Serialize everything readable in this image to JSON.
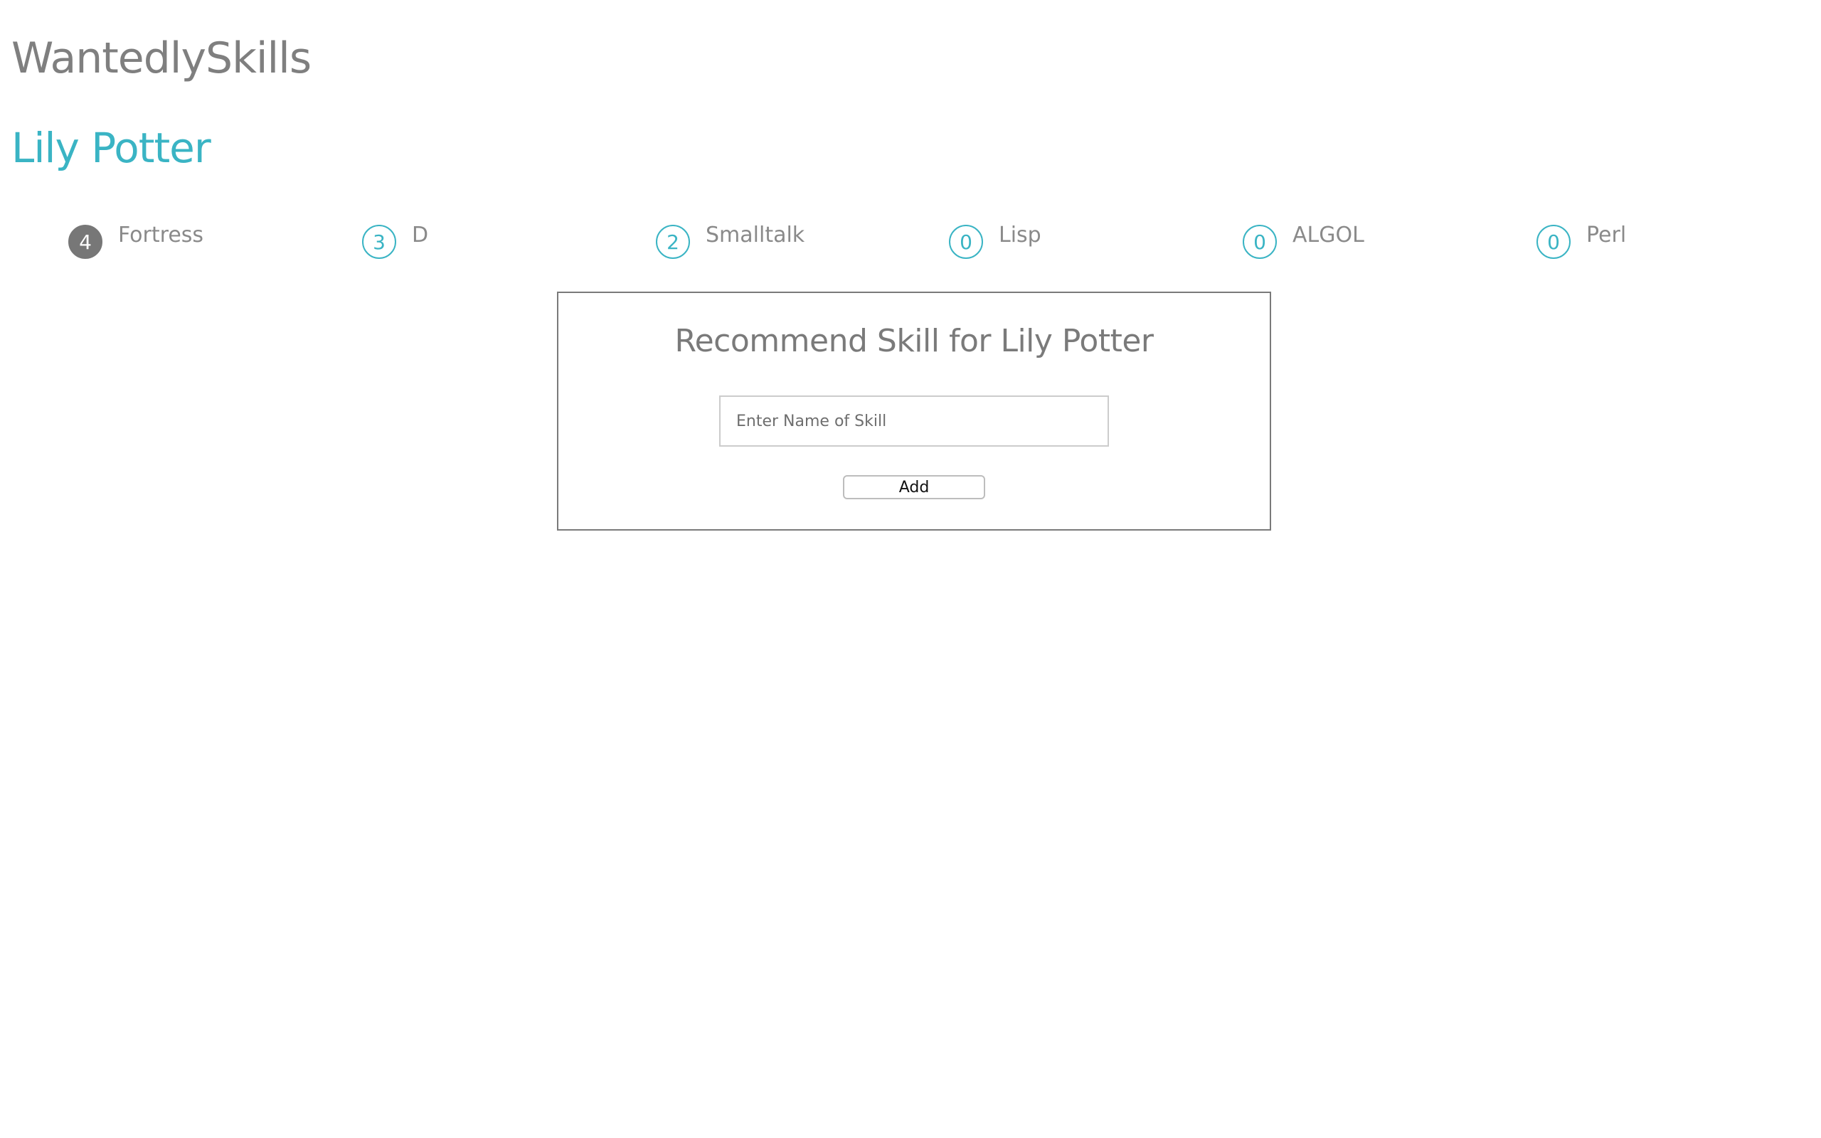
{
  "header": {
    "app_title": "WantedlySkills"
  },
  "profile": {
    "name": "Lily Potter"
  },
  "skills": [
    {
      "count": "4",
      "name": "Fortress",
      "active": true
    },
    {
      "count": "3",
      "name": "D",
      "active": false
    },
    {
      "count": "2",
      "name": "Smalltalk",
      "active": false
    },
    {
      "count": "0",
      "name": "Lisp",
      "active": false
    },
    {
      "count": "0",
      "name": "ALGOL",
      "active": false
    },
    {
      "count": "0",
      "name": "Perl",
      "active": false
    }
  ],
  "recommend": {
    "title": "Recommend Skill for Lily Potter",
    "input_placeholder": "Enter Name of Skill",
    "input_value": "",
    "add_label": "Add"
  },
  "colors": {
    "accent": "#3ab4c4",
    "active_badge": "#777777",
    "text_gray": "#7f7f7f"
  }
}
